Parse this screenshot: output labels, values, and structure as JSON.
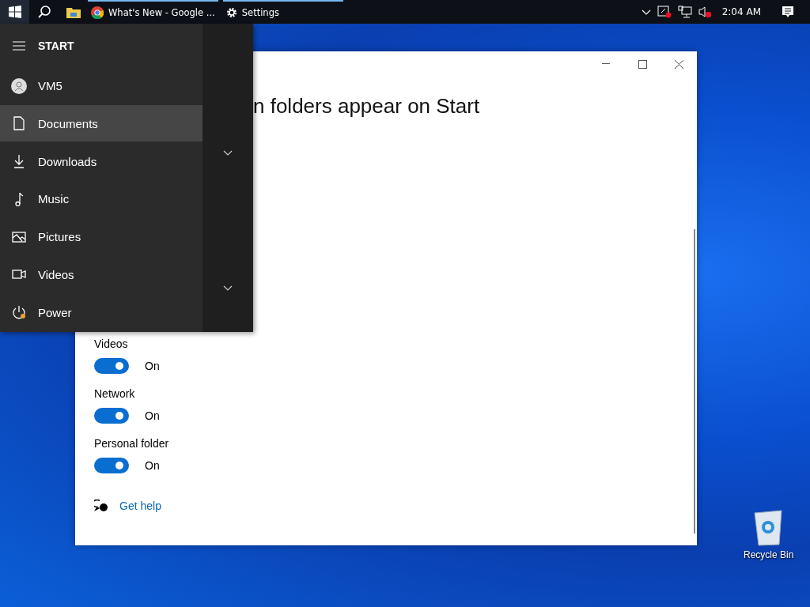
{
  "taskbar": {
    "apps": [
      {
        "kind": "browser",
        "label": "What's New - Google ...",
        "open": true
      },
      {
        "kind": "settings",
        "label": "Settings",
        "open": true
      }
    ],
    "clock": "2:04 AM"
  },
  "settings_window": {
    "heading": "n folders appear on Start",
    "toggles": [
      {
        "label": "Videos",
        "on": true,
        "state": "On"
      },
      {
        "label": "Network",
        "on": true,
        "state": "On"
      },
      {
        "label": "Personal folder",
        "on": true,
        "state": "On"
      }
    ],
    "help_link": "Get help"
  },
  "start_menu": {
    "title": "START",
    "items": [
      {
        "kind": "user",
        "label": "VM5",
        "selected": false
      },
      {
        "kind": "documents",
        "label": "Documents",
        "selected": true
      },
      {
        "kind": "downloads",
        "label": "Downloads",
        "selected": false
      },
      {
        "kind": "music",
        "label": "Music",
        "selected": false
      },
      {
        "kind": "pictures",
        "label": "Pictures",
        "selected": false
      },
      {
        "kind": "videos",
        "label": "Videos",
        "selected": false
      },
      {
        "kind": "power",
        "label": "Power",
        "selected": false
      }
    ]
  },
  "desktop_icons": [
    {
      "label": "Recycle Bin"
    }
  ]
}
